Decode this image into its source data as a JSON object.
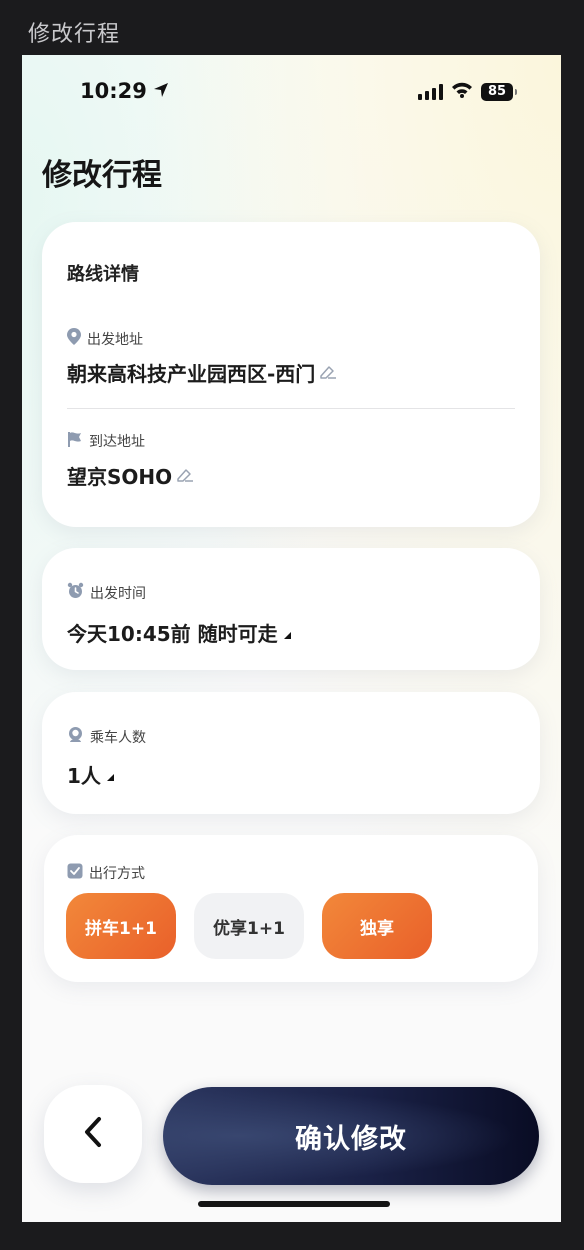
{
  "frame": {
    "title": "修改行程"
  },
  "status_bar": {
    "time": "10:29",
    "battery": "85"
  },
  "page": {
    "title": "修改行程"
  },
  "route": {
    "section_title": "路线详情",
    "departure_label": "出发地址",
    "departure_value": "朝来高科技产业园西区-西门",
    "arrival_label": "到达地址",
    "arrival_value": "望京SOHO"
  },
  "depart_time": {
    "label": "出发时间",
    "value": "今天10:45前 随时可走"
  },
  "passengers": {
    "label": "乘车人数",
    "value": "1人"
  },
  "travel_mode": {
    "label": "出行方式",
    "options": [
      {
        "label": "拼车1+1",
        "state": "selected"
      },
      {
        "label": "优享1+1",
        "state": "unselected"
      },
      {
        "label": "独享",
        "state": "selected"
      }
    ]
  },
  "footer": {
    "confirm_label": "确认修改"
  },
  "colors": {
    "accent_orange": "#ED6F2E",
    "confirm_navy": "#1A2146"
  }
}
